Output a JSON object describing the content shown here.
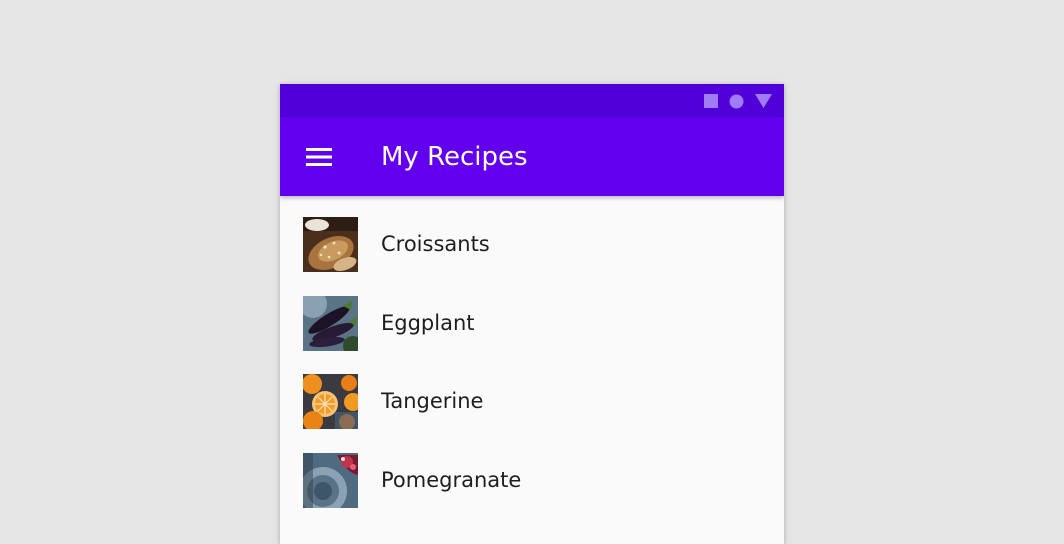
{
  "status_bar": {
    "icons": [
      "square-icon",
      "circle-icon",
      "triangle-icon"
    ],
    "background": "#5000d8",
    "icon_color": "#a07cf5"
  },
  "app_bar": {
    "title": "My Recipes",
    "menu_icon": "hamburger-menu-icon",
    "background": "#6200ee",
    "text_color": "#ffffff"
  },
  "recipes": [
    {
      "label": "Croissants",
      "image": "croissants-thumbnail"
    },
    {
      "label": "Eggplant",
      "image": "eggplant-thumbnail"
    },
    {
      "label": "Tangerine",
      "image": "tangerine-thumbnail"
    },
    {
      "label": "Pomegranate",
      "image": "pomegranate-thumbnail"
    }
  ]
}
